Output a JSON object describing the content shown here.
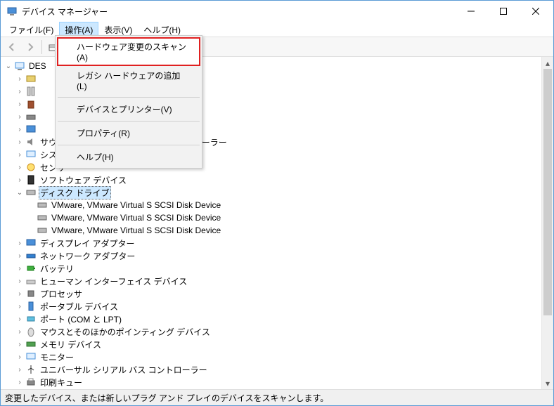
{
  "window": {
    "title": "デバイス マネージャー"
  },
  "menubar": {
    "file": "ファイル(F)",
    "action": "操作(A)",
    "view": "表示(V)",
    "help": "ヘルプ(H)"
  },
  "dropdown": {
    "scan": "ハードウェア変更のスキャン(A)",
    "legacy": "レガシ ハードウェアの追加(L)",
    "devprint": "デバイスとプリンター(V)",
    "properties": "プロパティ(R)",
    "help": "ヘルプ(H)"
  },
  "tree": {
    "root": "DES",
    "items": [
      {
        "label": "",
        "selected": false
      },
      {
        "label": "",
        "selected": false
      },
      {
        "label": "",
        "selected": false
      },
      {
        "label": "",
        "selected": false
      },
      {
        "label": "",
        "selected": false
      },
      {
        "label": "サウンド、ビデオ、およびゲーム コントローラー",
        "selected": false
      },
      {
        "label": "システム デバイス",
        "selected": false
      },
      {
        "label": "センサー",
        "selected": false
      },
      {
        "label": "ソフトウェア デバイス",
        "selected": false
      },
      {
        "label": "ディスク ドライブ",
        "selected": true,
        "expanded": true,
        "children": [
          "VMware, VMware Virtual S SCSI Disk Device",
          "VMware, VMware Virtual S SCSI Disk Device",
          "VMware, VMware Virtual S SCSI Disk Device"
        ]
      },
      {
        "label": "ディスプレイ アダプター",
        "selected": false
      },
      {
        "label": "ネットワーク アダプター",
        "selected": false
      },
      {
        "label": "バッテリ",
        "selected": false
      },
      {
        "label": "ヒューマン インターフェイス デバイス",
        "selected": false
      },
      {
        "label": "プロセッサ",
        "selected": false
      },
      {
        "label": "ポータブル デバイス",
        "selected": false
      },
      {
        "label": "ポート (COM と LPT)",
        "selected": false
      },
      {
        "label": "マウスとそのほかのポインティング デバイス",
        "selected": false
      },
      {
        "label": "メモリ デバイス",
        "selected": false
      },
      {
        "label": "モニター",
        "selected": false
      },
      {
        "label": "ユニバーサル シリアル バス コントローラー",
        "selected": false
      },
      {
        "label": "印刷キュー",
        "selected": false
      }
    ]
  },
  "statusbar": "変更したデバイス、または新しいプラグ アンド プレイのデバイスをスキャンします。"
}
